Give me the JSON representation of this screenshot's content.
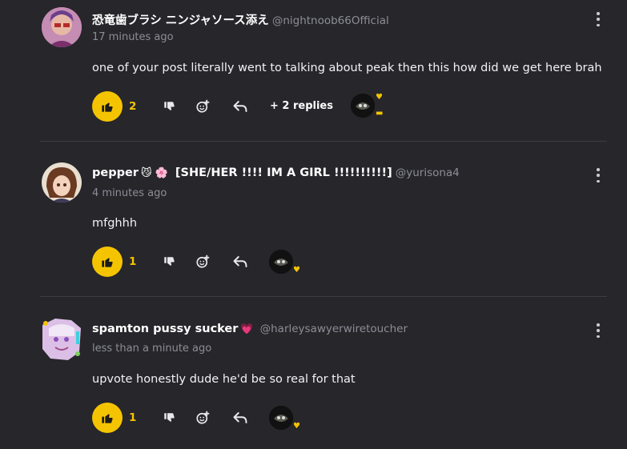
{
  "comments": [
    {
      "name": "恐竜歯ブラシ ニンジャソース添え",
      "handle": "@nightnoob66Official",
      "time": "17 minutes ago",
      "text": "one of your post literally went to talking about peak then this how did we get here brah",
      "likes": "2",
      "replies_label": "+ 2 replies"
    },
    {
      "name": "pepper",
      "name_emoji": "😼 🌸",
      "name_suffix": "[SHE/HER !!!! IM A GIRL !!!!!!!!!!]",
      "handle": "@yurisona4",
      "time": "4 minutes ago",
      "text": "mfghhh",
      "likes": "1"
    },
    {
      "name": "spamton pussy sucker",
      "name_emoji": "💗",
      "handle": "@harleysawyerwiretoucher",
      "time": "less than a minute ago",
      "text": "upvote honestly dude he'd be so real for that",
      "likes": "1"
    }
  ],
  "colors": {
    "background": "#26262b",
    "accent": "#f5c400",
    "muted": "#8d8d96"
  },
  "icons": [
    "thumbs-up-icon",
    "thumbs-down-icon",
    "add-reaction-icon",
    "reply-icon",
    "more-options-icon",
    "heart-icon",
    "speech-bubble-icon"
  ]
}
